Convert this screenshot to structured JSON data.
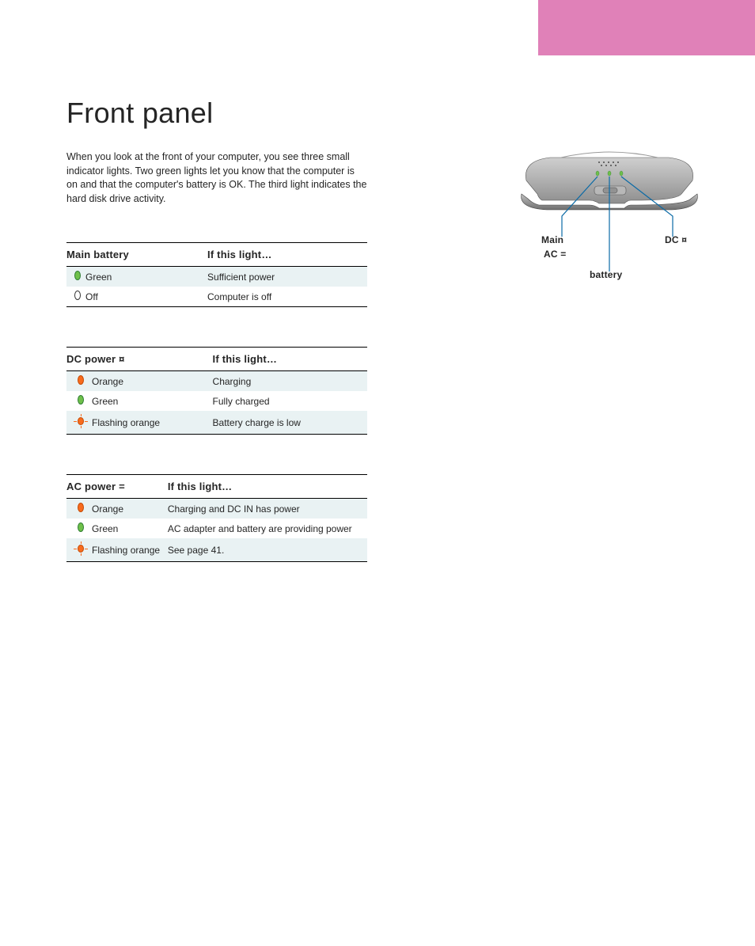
{
  "tab_color": "#e081b8",
  "title": "Front panel",
  "intro": "When you look at the front of your computer, you see three small indicator lights. Two green lights let you know that the computer is on and that the computer's battery is OK. The third light indicates the hard disk drive activity.",
  "tables": [
    {
      "header_if": "Main battery",
      "header_means": "If this light…",
      "rows": [
        {
          "icon": "green-solid",
          "label": "Green",
          "means": "Sufficient power",
          "shade": true
        },
        {
          "icon": "empty",
          "label": "Off",
          "means": "Computer is off",
          "shade": false,
          "last": true
        }
      ]
    },
    {
      "header_if": "DC power ¤",
      "header_means": "If this light…",
      "rows": [
        {
          "icon": "orange-solid",
          "label": "Orange",
          "means": "Charging",
          "shade": true
        },
        {
          "icon": "green-solid",
          "label": "Green",
          "means": "Fully charged",
          "shade": false
        },
        {
          "icon": "orange-flash",
          "label": "Flashing orange",
          "means": "Battery charge is low",
          "shade": true,
          "last": true
        }
      ]
    },
    {
      "header_if": "AC power =",
      "header_means": "If this light…",
      "rows": [
        {
          "icon": "orange-solid",
          "label": "Orange",
          "means": "Charging and DC IN has power",
          "shade": true
        },
        {
          "icon": "green-solid",
          "label": "Green",
          "means": "AC adapter and battery are providing power",
          "shade": false
        },
        {
          "icon": "orange-flash",
          "label": "Flashing orange",
          "means": "See page 41.",
          "shade": true,
          "last": true
        }
      ]
    }
  ],
  "device_labels": {
    "main": "Main",
    "ac": "AC =",
    "dc": "DC ¤",
    "battery": "battery"
  }
}
